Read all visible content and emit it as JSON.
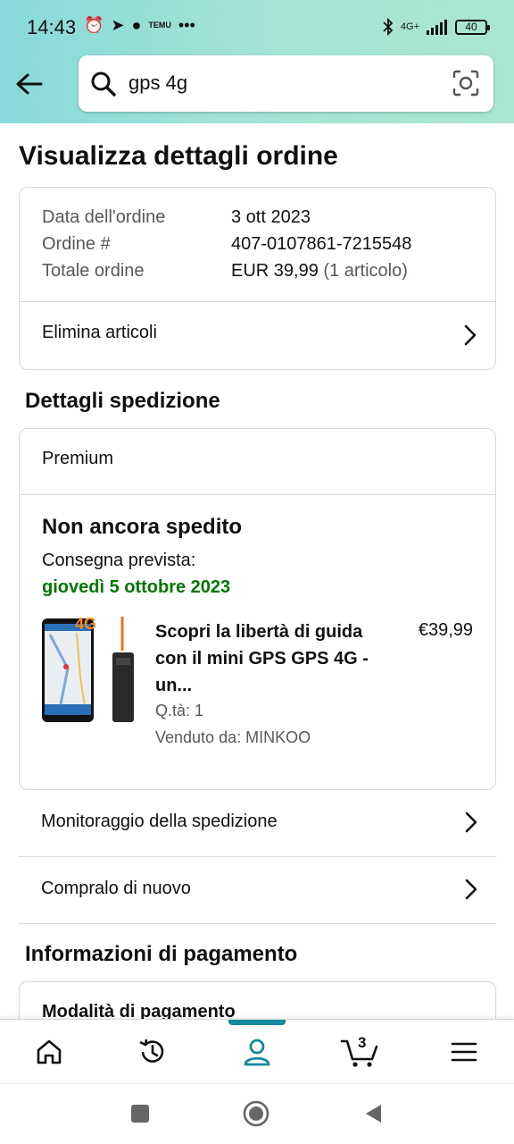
{
  "status_bar": {
    "time": "14:43",
    "app_icon_labels": [
      "⏰",
      "➤",
      "●",
      "TEMU",
      "•••"
    ],
    "network": "4G+",
    "battery": "40"
  },
  "search": {
    "value": "gps 4g"
  },
  "page": {
    "title": "Visualizza dettagli ordine"
  },
  "order_summary": {
    "date_label": "Data dell'ordine",
    "date_value": "3 ott 2023",
    "number_label": "Ordine #",
    "number_value": "407-0107861-7215548",
    "total_label": "Totale ordine",
    "total_value": "EUR 39,99",
    "total_qty": "(1 articolo)",
    "delete_items": "Elimina articoli"
  },
  "shipment": {
    "section_title": "Dettagli spedizione",
    "service": "Premium",
    "status": "Non ancora spedito",
    "expected_label": "Consegna prevista:",
    "expected_date": "giovedì 5 ottobre 2023",
    "product": {
      "title": "Scopri la libertà di guida con il mini GPS GPS 4G - un...",
      "price": "€39,99",
      "qty": "Q.tà: 1",
      "seller": "Venduto da: MINKOO",
      "image_badge": "4G"
    }
  },
  "actions": {
    "track": "Monitoraggio della spedizione",
    "buy_again": "Compralo di nuovo"
  },
  "payment": {
    "section_title": "Informazioni di pagamento",
    "method_label": "Modalità di pagamento"
  },
  "bottom_nav": {
    "cart_count": "3",
    "active": "account"
  },
  "colors": {
    "accent": "#138b9c",
    "delivery_green": "#007600",
    "header_gradient_start": "#88d9db",
    "header_gradient_end": "#abe5cf"
  }
}
